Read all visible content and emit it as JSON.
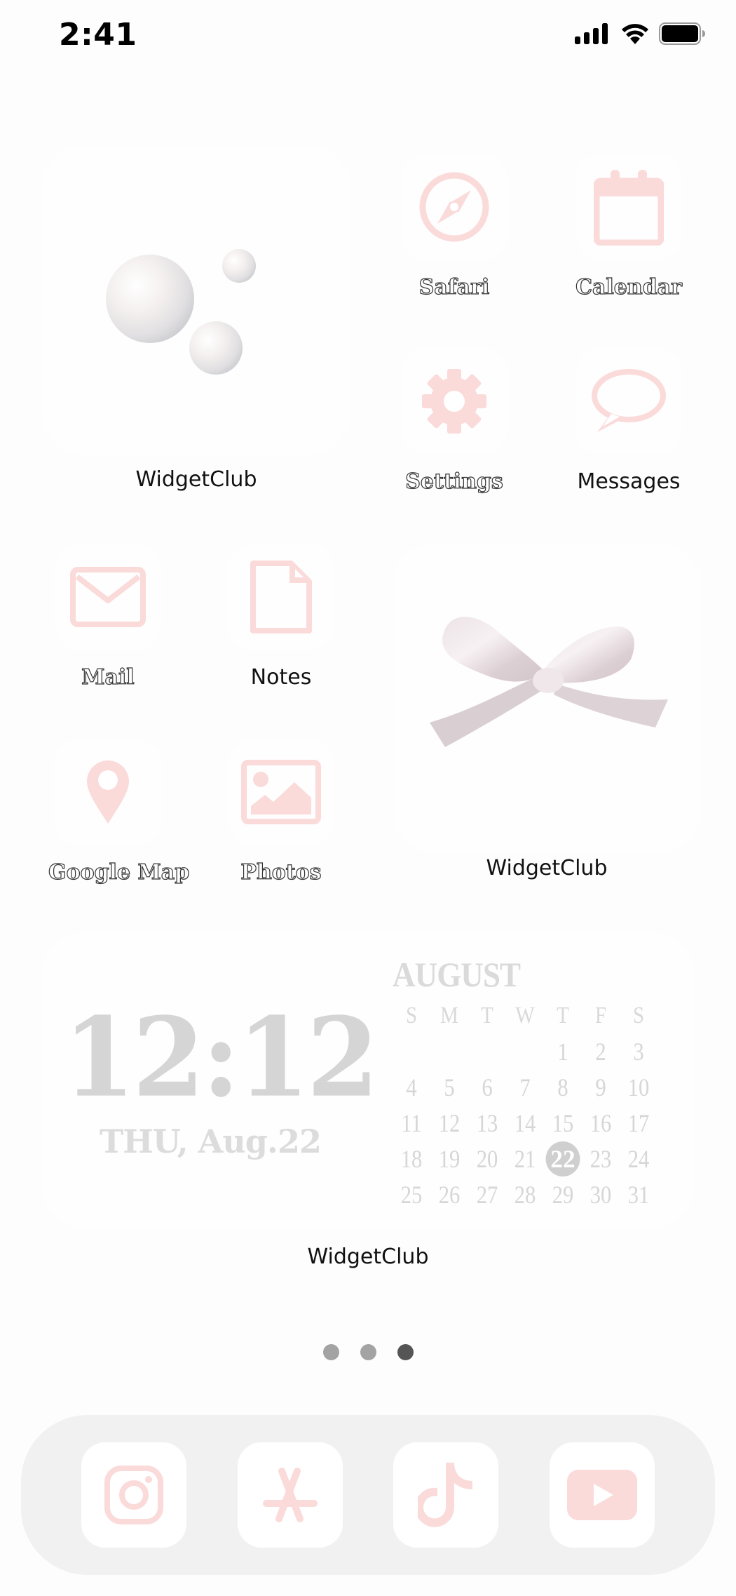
{
  "status_bar": {
    "time": "2:41",
    "icons": [
      "cellular-signal-icon",
      "wifi-icon",
      "battery-icon"
    ]
  },
  "accent_color": "#fbdada",
  "widgets": {
    "pearl": {
      "label": "WidgetClub",
      "image": "pearls"
    },
    "bow": {
      "label": "WidgetClub",
      "image": "satin-bow"
    },
    "clock_calendar": {
      "label": "WidgetClub",
      "time": "12:12",
      "date": "THU, Aug.22",
      "calendar": {
        "month": "AUGUST",
        "weekdays": [
          "S",
          "M",
          "T",
          "W",
          "T",
          "F",
          "S"
        ],
        "leading_blanks": 4,
        "days": [
          "1",
          "2",
          "3",
          "4",
          "5",
          "6",
          "7",
          "8",
          "9",
          "10",
          "11",
          "12",
          "13",
          "14",
          "15",
          "16",
          "17",
          "18",
          "19",
          "20",
          "21",
          "22",
          "23",
          "24",
          "25",
          "26",
          "27",
          "28",
          "29",
          "30",
          "31"
        ],
        "today": "22"
      }
    }
  },
  "apps": [
    {
      "label": "Safari",
      "icon": "compass-icon",
      "style": "outline"
    },
    {
      "label": "Calendar",
      "icon": "calendar-icon",
      "style": "outline"
    },
    {
      "label": "Settings",
      "icon": "gear-icon",
      "style": "outline"
    },
    {
      "label": "Messages",
      "icon": "speech-bubble-icon",
      "style": "solid"
    },
    {
      "label": "Mail",
      "icon": "envelope-icon",
      "style": "outline"
    },
    {
      "label": "Notes",
      "icon": "document-icon",
      "style": "solid"
    },
    {
      "label": "Google Map",
      "icon": "map-pin-icon",
      "style": "outline"
    },
    {
      "label": "Photos",
      "icon": "photo-icon",
      "style": "outline"
    }
  ],
  "page_indicator": {
    "count": 3,
    "active": 3
  },
  "dock": [
    {
      "app": "Instagram",
      "icon": "instagram-icon"
    },
    {
      "app": "App Store",
      "icon": "app-store-icon"
    },
    {
      "app": "TikTok",
      "icon": "tiktok-icon"
    },
    {
      "app": "YouTube",
      "icon": "youtube-icon"
    }
  ]
}
